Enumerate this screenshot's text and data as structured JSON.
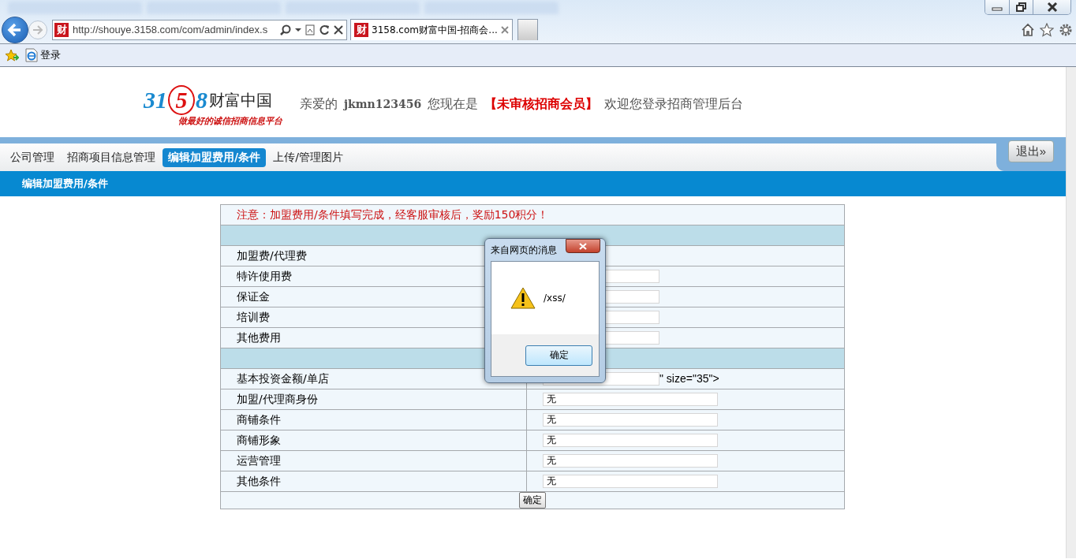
{
  "browser": {
    "address": {
      "favicon": "财",
      "url": "http://shouye.3158.com/com/admin/index.s"
    },
    "tab": {
      "favicon": "财",
      "title": "3158.com财富中国-招商会..."
    },
    "favorites": [
      {
        "label": "登录"
      }
    ]
  },
  "header": {
    "logo": {
      "parts": [
        {
          "text": "31",
          "accent": false
        },
        {
          "text": "5",
          "accent": true
        },
        {
          "text": "8",
          "accent": false
        }
      ],
      "name": "财富中国",
      "slogan": "做最好的诚信招商信息平台"
    },
    "greeting": [
      {
        "text": "亲爱的",
        "kind": "plain"
      },
      {
        "text": "jkmn123456",
        "kind": "user"
      },
      {
        "text": "您现在是",
        "kind": "plain"
      },
      {
        "text": "【未审核招商会员】",
        "kind": "status"
      },
      {
        "text": "欢迎您登录招商管理后台",
        "kind": "plain"
      }
    ]
  },
  "nav": {
    "tabs": [
      {
        "label": "公司管理",
        "selected": false
      },
      {
        "label": "招商项目信息管理",
        "selected": false
      },
      {
        "label": "编辑加盟费用/条件",
        "selected": true
      },
      {
        "label": "上传/管理图片",
        "selected": false
      }
    ],
    "logout": "退出»"
  },
  "subbar": {
    "title": "编辑加盟费用/条件"
  },
  "form": {
    "notice": "注意：加盟费用/条件填写完成，经客服审核后，奖励150积分！",
    "rows": [
      {
        "kind": "section"
      },
      {
        "kind": "label",
        "label": "加盟费/代理费"
      },
      {
        "kind": "input",
        "label": "特许使用费"
      },
      {
        "kind": "input",
        "label": "保证金"
      },
      {
        "kind": "input",
        "label": "培训费"
      },
      {
        "kind": "input",
        "label": "其他费用"
      },
      {
        "kind": "section"
      },
      {
        "kind": "input",
        "label": "基本投资金额/单店",
        "suffix": "\" size=\"35\">"
      },
      {
        "kind": "input",
        "label": "加盟/代理商身份",
        "value": "无"
      },
      {
        "kind": "input",
        "label": "商铺条件",
        "value": "无"
      },
      {
        "kind": "input",
        "label": "商铺形象",
        "value": "无"
      },
      {
        "kind": "input",
        "label": "运营管理",
        "value": "无"
      },
      {
        "kind": "input",
        "label": "其他条件",
        "value": "无"
      }
    ],
    "submit": "确定"
  },
  "dialog": {
    "title": "来自网页的消息",
    "message": "/xss/",
    "button": "确定"
  }
}
